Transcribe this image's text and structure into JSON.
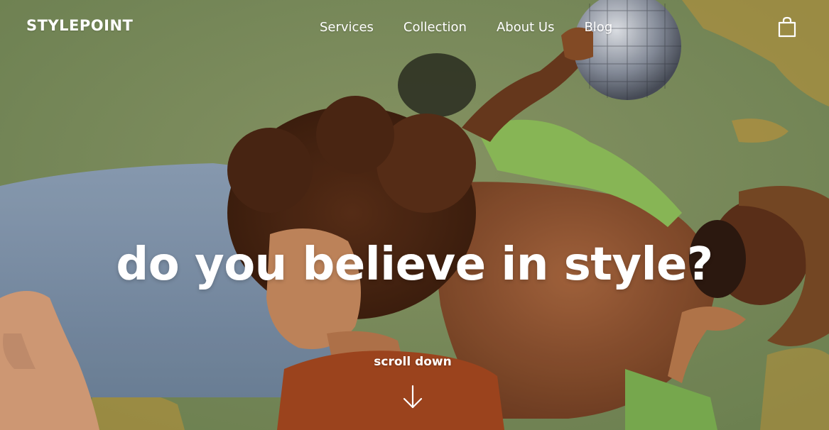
{
  "brand": {
    "logo_text": "STYLEPOINT"
  },
  "nav": {
    "items": [
      {
        "label": "Services"
      },
      {
        "label": "Collection"
      },
      {
        "label": "About Us"
      },
      {
        "label": "Blog"
      }
    ]
  },
  "header": {
    "cart_icon": "shopping-bag-icon"
  },
  "hero": {
    "headline": "do you believe in style?",
    "scroll_label": "scroll down",
    "scroll_icon": "arrow-down-icon",
    "background": "photo of two people lying on grass with a disco ball",
    "colors": {
      "grass": "#7f9160",
      "text": "#ffffff",
      "top_rust": "#a4471f"
    }
  }
}
